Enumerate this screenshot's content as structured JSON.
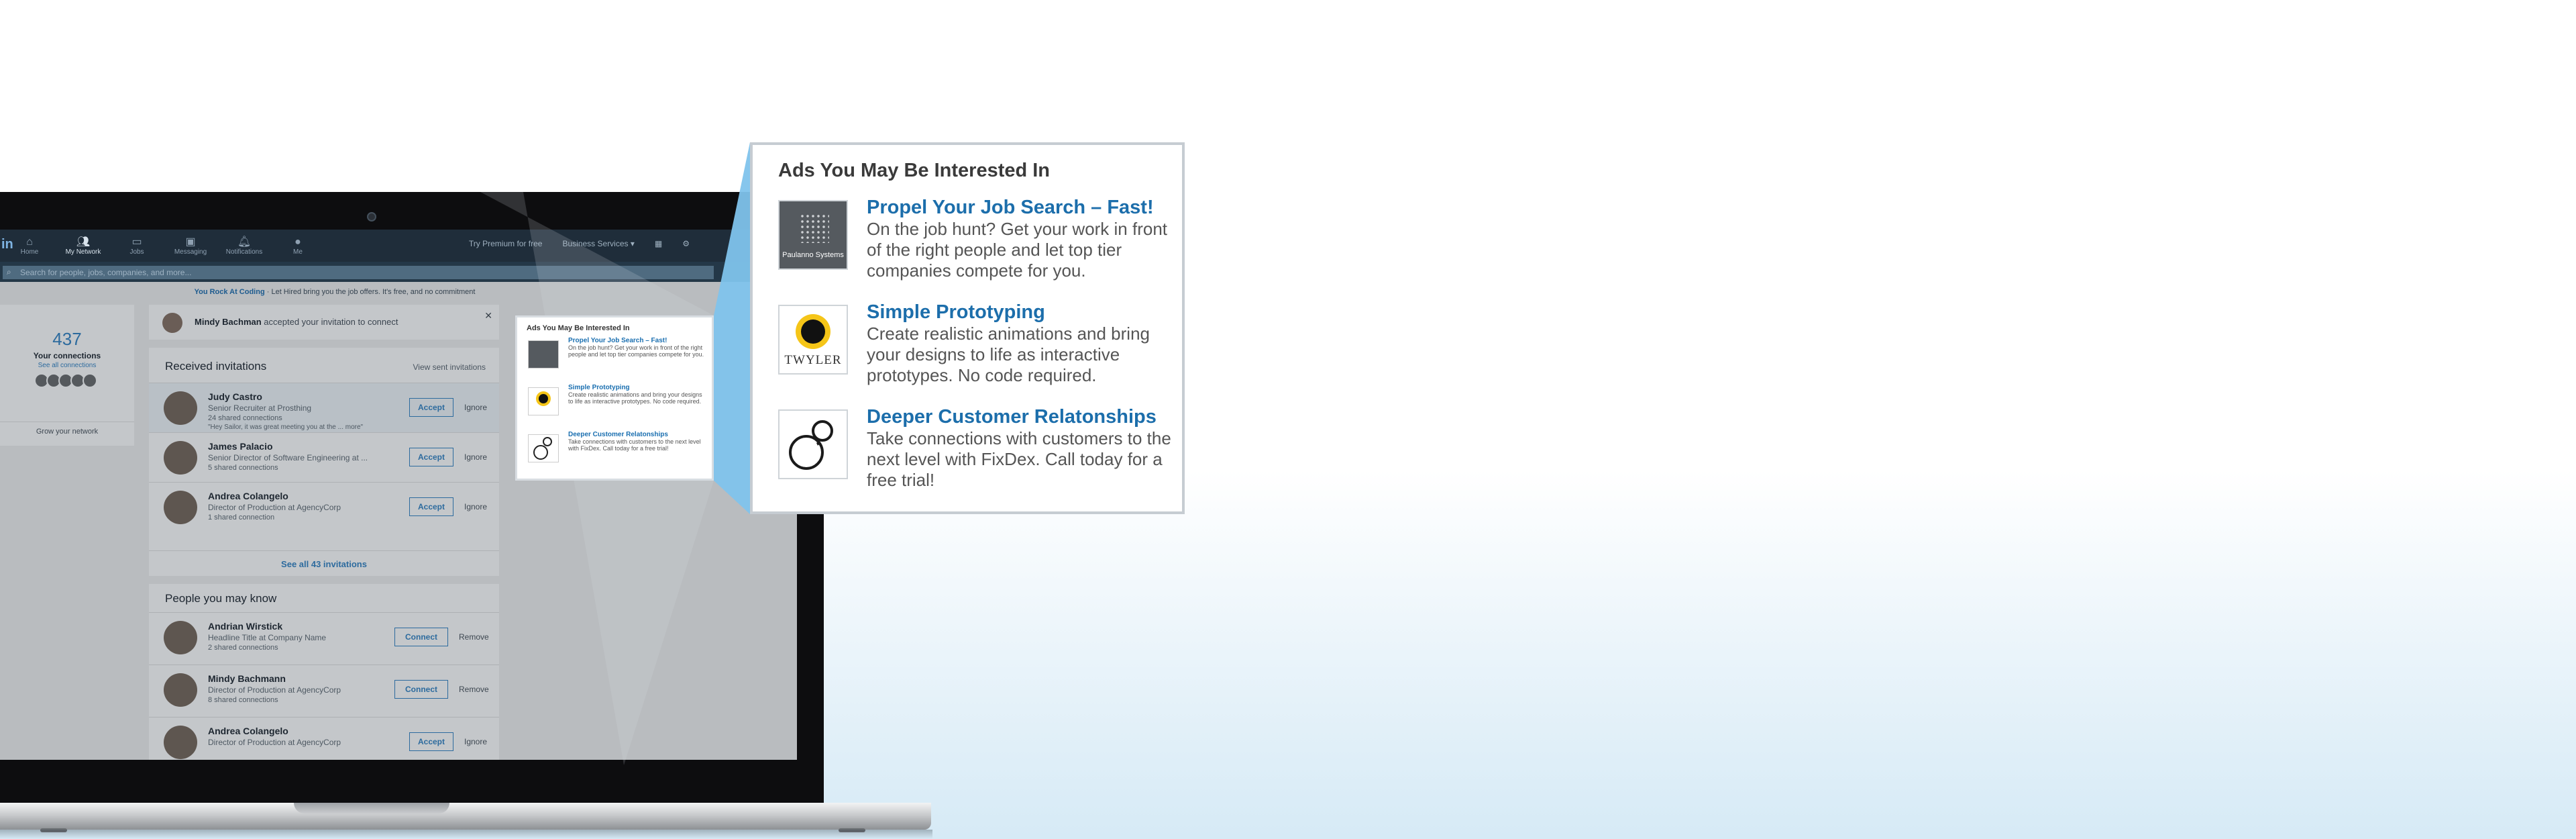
{
  "app": {
    "logo": "in",
    "nav": [
      {
        "label": "Home",
        "icon": "home-icon"
      },
      {
        "label": "My Network",
        "icon": "people-icon"
      },
      {
        "label": "Jobs",
        "icon": "briefcase-icon"
      },
      {
        "label": "Messaging",
        "icon": "chat-icon"
      },
      {
        "label": "Notifications",
        "icon": "bell-icon"
      },
      {
        "label": "Me",
        "icon": "avatar-icon"
      }
    ],
    "premium": "Try Premium for free",
    "business": "Business Services ▾",
    "search_placeholder": "Search for people, jobs, companies, and more...",
    "promo_brand": "You Rock At Coding",
    "promo_text": " · Let Hired bring you the job offers. It's free, and no commitment",
    "connections": {
      "count": "437",
      "label": "Your connections",
      "see_all": "See all connections",
      "grow": "Grow your network"
    },
    "notice": {
      "name": "Mindy Bachman",
      "text": " accepted your invitation to connect"
    },
    "invitations": {
      "title": "Received invitations",
      "sent_link": "View sent invitations",
      "accept": "Accept",
      "ignore": "Ignore",
      "see_all": "See all 43 invitations",
      "items": [
        {
          "name": "Judy Castro",
          "role": "Senior Recruiter at Prosthing",
          "shared": "24 shared connections",
          "quote": "\"Hey Sailor, it was great meeting you at the ... more\""
        },
        {
          "name": "James Palacio",
          "role": "Senior Director of Software Engineering at ...",
          "shared": "5 shared connections",
          "quote": ""
        },
        {
          "name": "Andrea Colangelo",
          "role": "Director of Production at AgencyCorp",
          "shared": "1 shared connection",
          "quote": ""
        }
      ]
    },
    "pymk": {
      "title": "People you may know",
      "connect": "Connect",
      "remove": "Remove",
      "accept": "Accept",
      "ignore": "Ignore",
      "items": [
        {
          "name": "Andrian Wirstick",
          "role": "Headline Title at Company Name",
          "shared": "2 shared connections"
        },
        {
          "name": "Mindy Bachmann",
          "role": "Director of Production at AgencyCorp",
          "shared": "8 shared connections"
        },
        {
          "name": "Andrea Colangelo",
          "role": "Director of Production at AgencyCorp",
          "shared": ""
        }
      ]
    }
  },
  "ads": {
    "heading": "Ads You May Be Interested In",
    "items": [
      {
        "title": "Propel Your Job Search – Fast!",
        "body": "On the job hunt? Get your work in front of the right people and let top tier companies compete for you.",
        "brand": "Paulanno Systems"
      },
      {
        "title": "Simple Prototyping",
        "body": "Create realistic animations and bring your designs to life as interactive prototypes. No code required.",
        "brand": "TWYLER"
      },
      {
        "title": "Deeper Customer Relatonships",
        "body": "Take connections with customers to the next level with FixDex. Call today for a free trial!",
        "brand": ""
      }
    ]
  },
  "colors": {
    "accent": "#1c6eab",
    "screen_bar": "#1f2d3a",
    "beam": "#7fc3ec"
  }
}
